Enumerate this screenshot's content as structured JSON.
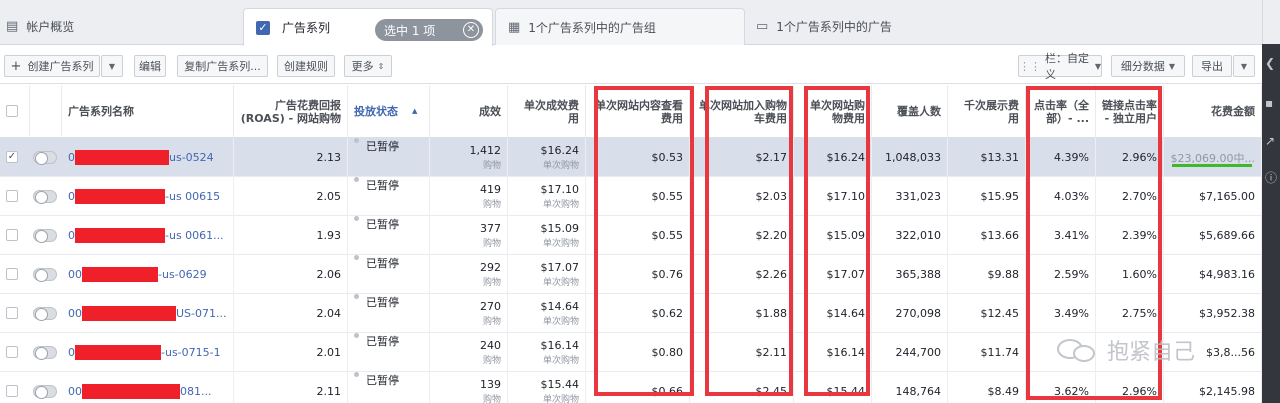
{
  "tabs": [
    {
      "icon": "account-overview-icon",
      "label": "帐户概览"
    },
    {
      "icon": "checkbox-icon",
      "label": "广告系列",
      "selected_pill": "选中 1 项"
    },
    {
      "icon": "ad-sets-icon",
      "label": "1个广告系列中的广告组"
    },
    {
      "icon": "ads-icon",
      "label": "1个广告系列中的广告"
    }
  ],
  "toolbar": {
    "create": "创建广告系列",
    "edit": "编辑",
    "duplicate": "复制广告系列...",
    "create_rule": "创建规则",
    "more": "更多",
    "columns": "栏：自定义",
    "breakdown": "细分数据",
    "export": "导出"
  },
  "columns": [
    "广告系列名称",
    "广告花费回报 (ROAS) - 网站购物",
    "投放状态",
    "成效",
    "单次成效费用",
    "单次网站内容查看费用",
    "单次网站加入购物车费用",
    "单次网站购物费用",
    "覆盖人数",
    "千次展示费用",
    "点击率（全部）- ...",
    "链接点击率 - 独立用户",
    "花费金额"
  ],
  "rows": [
    {
      "name_prefix": "0",
      "name_suffix": "us-0524",
      "roas": "2.13",
      "status": "已暂停",
      "results": "1,412",
      "results_sub": "购物",
      "cpr": "$16.24",
      "cpr_sub": "单次购物",
      "cpvc": "$0.53",
      "cpatc": "$2.17",
      "cpp": "$16.24",
      "reach": "1,048,033",
      "cpm": "$13.31",
      "ctr": "4.39%",
      "lctr": "2.96%",
      "spend": "$23,069.00中...",
      "selected": true
    },
    {
      "name_prefix": "0",
      "name_suffix": "-us 00615",
      "roas": "2.05",
      "status": "已暂停",
      "results": "419",
      "results_sub": "购物",
      "cpr": "$17.10",
      "cpr_sub": "单次购物",
      "cpvc": "$0.55",
      "cpatc": "$2.03",
      "cpp": "$17.10",
      "reach": "331,023",
      "cpm": "$15.95",
      "ctr": "4.03%",
      "lctr": "2.70%",
      "spend": "$7,165.00"
    },
    {
      "name_prefix": "0",
      "name_suffix": "-us 0061...",
      "roas": "1.93",
      "status": "已暂停",
      "results": "377",
      "results_sub": "购物",
      "cpr": "$15.09",
      "cpr_sub": "单次购物",
      "cpvc": "$0.55",
      "cpatc": "$2.20",
      "cpp": "$15.09",
      "reach": "322,010",
      "cpm": "$13.66",
      "ctr": "3.41%",
      "lctr": "2.39%",
      "spend": "$5,689.66"
    },
    {
      "name_prefix": "00",
      "name_suffix": "-us-0629",
      "roas": "2.06",
      "status": "已暂停",
      "results": "292",
      "results_sub": "购物",
      "cpr": "$17.07",
      "cpr_sub": "单次购物",
      "cpvc": "$0.76",
      "cpatc": "$2.26",
      "cpp": "$17.07",
      "reach": "365,388",
      "cpm": "$9.88",
      "ctr": "2.59%",
      "lctr": "1.60%",
      "spend": "$4,983.16"
    },
    {
      "name_prefix": "00",
      "name_suffix": "US-071...",
      "roas": "2.04",
      "status": "已暂停",
      "results": "270",
      "results_sub": "购物",
      "cpr": "$14.64",
      "cpr_sub": "单次购物",
      "cpvc": "$0.62",
      "cpatc": "$1.88",
      "cpp": "$14.64",
      "reach": "270,098",
      "cpm": "$12.45",
      "ctr": "3.49%",
      "lctr": "2.75%",
      "spend": "$3,952.38"
    },
    {
      "name_prefix": "0",
      "name_suffix": "-us-0715-1",
      "roas": "2.01",
      "status": "已暂停",
      "results": "240",
      "results_sub": "购物",
      "cpr": "$16.14",
      "cpr_sub": "单次购物",
      "cpvc": "$0.80",
      "cpatc": "$2.11",
      "cpp": "$16.14",
      "reach": "244,700",
      "cpm": "$11.74",
      "ctr": "",
      "lctr": "",
      "spend": "$3,8...56"
    },
    {
      "name_prefix": "00",
      "name_suffix": "081...",
      "roas": "2.11",
      "status": "已暂停",
      "results": "139",
      "results_sub": "购物",
      "cpr": "$15.44",
      "cpr_sub": "单次购物",
      "cpvc": "$0.66",
      "cpatc": "$2.45",
      "cpp": "$15.44",
      "reach": "148,764",
      "cpm": "$8.49",
      "ctr": "3.62%",
      "lctr": "2.96%",
      "spend": "$2,145.98"
    }
  ],
  "watermark": "抱紧自己",
  "colors": {
    "highlight": "#e8373e",
    "link": "#4267b2",
    "selected_row": "#d8dfea",
    "spend_bar": "#42b72a"
  }
}
